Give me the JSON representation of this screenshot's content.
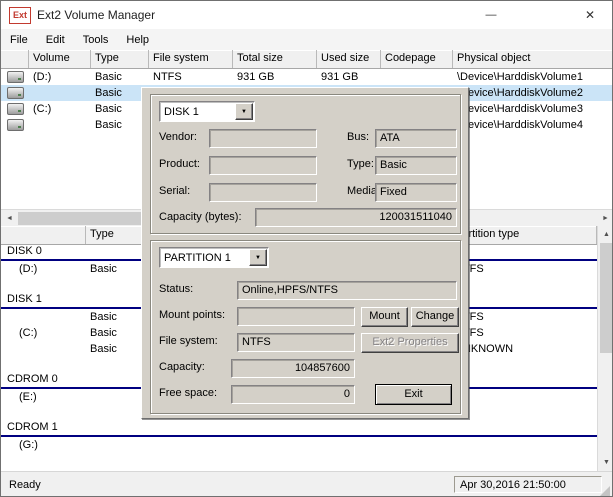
{
  "window": {
    "icon_text": "Ext",
    "title": "Ext2 Volume Manager"
  },
  "icons": {
    "minimize": "—",
    "close": "✕",
    "dropdown": "▼",
    "scroll_left": "◄",
    "scroll_right": "►",
    "scroll_up": "▲",
    "scroll_down": "▼"
  },
  "menu": {
    "items": [
      {
        "label": "File"
      },
      {
        "label": "Edit"
      },
      {
        "label": "Tools"
      },
      {
        "label": "Help"
      }
    ]
  },
  "volume_list": {
    "columns": [
      "Volume",
      "Type",
      "File system",
      "Total size",
      "Used size",
      "Codepage",
      "Physical object"
    ],
    "rows": [
      {
        "volume": "(D:)",
        "type": "Basic",
        "file_system": "NTFS",
        "total_size": "931 GB",
        "used_size": "931 GB",
        "codepage": "",
        "physical_object": "\\Device\\HarddiskVolume1"
      },
      {
        "volume": "",
        "type": "Basic",
        "file_system": "",
        "total_size": "",
        "used_size": "",
        "codepage": "",
        "physical_object": "\\Device\\HarddiskVolume2"
      },
      {
        "volume": "(C:)",
        "type": "Basic",
        "file_system": "",
        "total_size": "",
        "used_size": "",
        "codepage": "",
        "physical_object": "\\Device\\HarddiskVolume3"
      },
      {
        "volume": "",
        "type": "Basic",
        "file_system": "",
        "total_size": "",
        "used_size": "",
        "codepage": "",
        "physical_object": "\\Device\\HarddiskVolume4"
      }
    ]
  },
  "disk_list": {
    "columns": [
      "",
      "Type",
      "Partition type"
    ],
    "rows": [
      {
        "label": "DISK 0",
        "type": "",
        "partition_type": ""
      },
      {
        "label": "(D:)",
        "type": "Basic",
        "partition_type": "NTFS"
      },
      {
        "label": "DISK 1",
        "type": "",
        "partition_type": ""
      },
      {
        "label": "",
        "type": "Basic",
        "partition_type": "NTFS"
      },
      {
        "label": "(C:)",
        "type": "Basic",
        "partition_type": "NTFS"
      },
      {
        "label": "",
        "type": "Basic",
        "partition_type": "UNKNOWN"
      },
      {
        "label": "CDROM 0",
        "type": "",
        "partition_type": ""
      },
      {
        "label": "(E:)",
        "type": "",
        "partition_type": ""
      },
      {
        "label": "CDROM 1",
        "type": "",
        "partition_type": ""
      },
      {
        "label": "(G:)",
        "type": "",
        "partition_type": ""
      }
    ]
  },
  "dialog": {
    "disk_selector": {
      "value": "DISK 1"
    },
    "disk_fields": {
      "vendor_label": "Vendor:",
      "vendor": "",
      "product_label": "Product:",
      "product": "",
      "serial_label": "Serial:",
      "serial": "",
      "bus_label": "Bus:",
      "bus": "ATA",
      "type_label": "Type:",
      "type": "Basic",
      "media_label": "Media:",
      "media": "Fixed",
      "capacity_label": "Capacity (bytes):",
      "capacity": "120031511040"
    },
    "partition_selector": {
      "value": "PARTITION 1"
    },
    "partition_fields": {
      "status_label": "Status:",
      "status": "Online,HPFS/NTFS",
      "mount_points_label": "Mount points:",
      "mount_points": "",
      "file_system_label": "File system:",
      "file_system": "NTFS",
      "capacity_label": "Capacity:",
      "capacity": "104857600",
      "free_space_label": "Free space:",
      "free_space": "0"
    },
    "buttons": {
      "mount": "Mount",
      "change": "Change",
      "ext2_properties": "Ext2 Properties",
      "exit": "Exit"
    }
  },
  "status_bar": {
    "ready": "Ready",
    "datetime": "Apr 30,2016 21:50:00"
  }
}
